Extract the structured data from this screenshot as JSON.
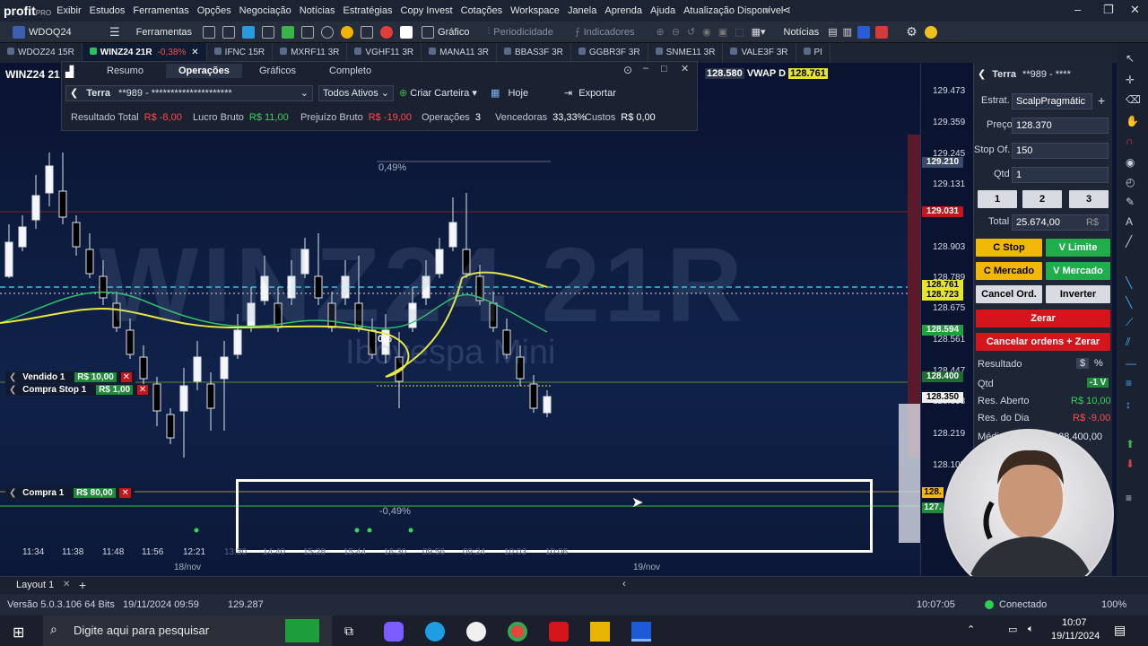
{
  "app": {
    "logo": "profit",
    "logo_suffix": "PRO"
  },
  "menu": [
    "Exibir",
    "Estudos",
    "Ferramentas",
    "Opções",
    "Negociação",
    "Notícias",
    "Estratégias",
    "Copy Invest",
    "Cotações",
    "Workspace",
    "Janela",
    "Aprenda",
    "Ajuda",
    "Atualização Disponível"
  ],
  "toolbar": {
    "symbol": "WDOQ24",
    "ferramentas": "Ferramentas",
    "grafico": "Gráfico",
    "periodicidade": "Periodicidade",
    "indicadores": "Indicadores",
    "noticias": "Notícias"
  },
  "tabs": [
    {
      "label": "WDOZ24 15R",
      "active": false
    },
    {
      "label": "WINZ24 21R",
      "active": true,
      "change": "-0,38%"
    },
    {
      "label": "IFNC 15R",
      "active": false
    },
    {
      "label": "MXRF11 3R",
      "active": false
    },
    {
      "label": "VGHF11 3R",
      "active": false
    },
    {
      "label": "MANA11 3R",
      "active": false
    },
    {
      "label": "BBAS3F 3R",
      "active": false
    },
    {
      "label": "GGBR3F 3R",
      "active": false
    },
    {
      "label": "SNME11 3R",
      "active": false
    },
    {
      "label": "VALE3F 3R",
      "active": false
    },
    {
      "label": "PI",
      "active": false
    }
  ],
  "chart": {
    "symbol_title": "WINZ24 21",
    "watermark": "WINZ24 21R",
    "watermark_sub": "Ibovespa Mini",
    "vwap_value": "128.580",
    "vwap_label": "VWAP D",
    "vwap_tag": "128.761",
    "pct_top": "0,49%",
    "pct_mid": "0%",
    "pct_bottom": "-0,49%",
    "price_labels": [
      "129.473",
      "129.359",
      "129.245",
      "129.131",
      "128.903",
      "128.789",
      "128.675",
      "128.561",
      "128.447",
      "128.333",
      "128.219",
      "128.105"
    ],
    "price_tags": [
      {
        "value": "129.210",
        "bg": "#3a4a6a",
        "fg": "#ffffff"
      },
      {
        "value": "129.031",
        "bg": "#c4161c",
        "fg": "#ffffff"
      },
      {
        "value": "128.761",
        "bg": "#e5e52a",
        "fg": "#000000"
      },
      {
        "value": "128.723",
        "bg": "#e5e52a",
        "fg": "#000000"
      },
      {
        "value": "128.594",
        "bg": "#20a040",
        "fg": "#ffffff"
      },
      {
        "value": "128.400",
        "bg": "#1e6b34",
        "fg": "#ffffff"
      },
      {
        "value": "128.350",
        "bg": "#f0f0f0",
        "fg": "#000000"
      }
    ],
    "time_labels": [
      "11:34",
      "11:38",
      "11:48",
      "11:56",
      "12:21",
      "13:30",
      "14:40",
      "15:28",
      "15:44",
      "16:30",
      "09:56",
      "09:24",
      "10:03",
      "10:06"
    ],
    "date_labels": [
      "18/nov",
      "19/nov"
    ],
    "orders": [
      {
        "label": "Vendido 1",
        "value": "R$ 10,00"
      },
      {
        "label": "Compra Stop 1",
        "value": "R$ 1,00"
      },
      {
        "label": "Compra 1",
        "value": "R$ 80,00"
      }
    ],
    "bottom_tags": [
      "128.",
      "127."
    ]
  },
  "ops": {
    "tabs": [
      "Resumo",
      "Operações",
      "Gráficos",
      "Completo"
    ],
    "account": "Terra",
    "account_mask": "**989 - *********************",
    "filter": "Todos Ativos",
    "criar": "Criar Carteira",
    "hoje": "Hoje",
    "exportar": "Exportar",
    "stats": [
      {
        "label": "Resultado Total",
        "value": "R$ -8,00",
        "cls": "neg"
      },
      {
        "label": "Lucro Bruto",
        "value": "R$ 11,00",
        "cls": "pos"
      },
      {
        "label": "Prejuízo Bruto",
        "value": "R$ -19,00",
        "cls": "neg"
      },
      {
        "label": "Operações",
        "value": "3",
        "cls": ""
      },
      {
        "label": "Vencedoras",
        "value": "33,33%",
        "cls": ""
      },
      {
        "label": "Custos",
        "value": "R$ 0,00",
        "cls": ""
      }
    ]
  },
  "boleta": {
    "account": "Terra",
    "account_mask": "**989 - ****",
    "estrat_label": "Estrat.",
    "estrat_value": "ScalpPragmátic",
    "preco_label": "Preço",
    "preco_value": "128.370",
    "stop_label": "Stop Of.",
    "stop_value": "150",
    "qtd_label": "Qtd",
    "qtd_value": "1",
    "qty_buttons": [
      "1",
      "2",
      "3"
    ],
    "total_label": "Total",
    "total_value": "25.674,00",
    "total_unit": "R$",
    "c_stop": "C Stop",
    "v_limite": "V Limite",
    "c_mercado": "C Mercado",
    "v_mercado": "V Mercado",
    "cancel": "Cancel Ord.",
    "inverter": "Inverter",
    "zerar": "Zerar",
    "cancelar_zerar": "Cancelar ordens + Zerar",
    "resultado": "Resultado",
    "res_currency": "$",
    "res_pct": "%",
    "qtd2_label": "Qtd",
    "qtd2_value": "-1 V",
    "res_aberto_label": "Res. Aberto",
    "res_aberto_value": "R$ 10,00",
    "res_dia_label": "Res. do Dia",
    "res_dia_value": "R$ -9,00",
    "medio_label": "Médi",
    "medio_value": "128.400,00"
  },
  "layout": {
    "name": "Layout 1"
  },
  "status": {
    "version": "Versão 5.0.3.106 64 Bits",
    "datetime": "19/11/2024 09:59",
    "value": "129.287",
    "clock": "10:07:05",
    "connection": "Conectado",
    "zoom": "100%"
  },
  "taskbar": {
    "search_placeholder": "Digite aqui para pesquisar",
    "time": "10:07",
    "date": "19/11/2024"
  }
}
